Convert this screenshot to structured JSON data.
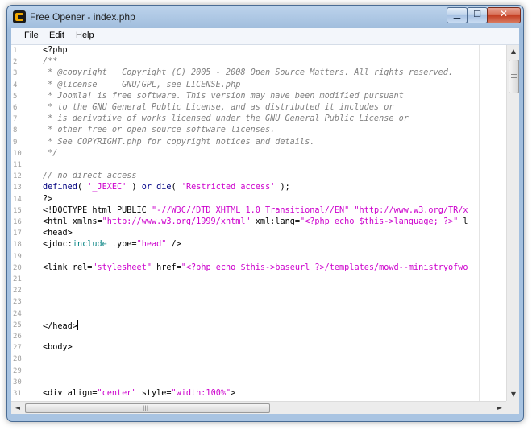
{
  "window": {
    "title": "Free Opener - index.php",
    "icon": "app-icon",
    "controls": {
      "minimize": "▁",
      "maximize": "☐",
      "close": "✕"
    }
  },
  "menubar": {
    "items": [
      "File",
      "Edit",
      "Help"
    ]
  },
  "editor": {
    "lines": [
      {
        "n": "1",
        "tokens": [
          {
            "t": "<?php",
            "c": "default"
          }
        ]
      },
      {
        "n": "2",
        "tokens": [
          {
            "t": "/**",
            "c": "comment"
          }
        ]
      },
      {
        "n": "3",
        "tokens": [
          {
            "t": " * @copyright   Copyright (C) 2005 - 2008 Open Source Matters. All rights reserved.",
            "c": "comment"
          }
        ]
      },
      {
        "n": "4",
        "tokens": [
          {
            "t": " * @license     GNU/GPL, see LICENSE.php",
            "c": "comment"
          }
        ]
      },
      {
        "n": "5",
        "tokens": [
          {
            "t": " * Joomla! is free software. This version may have been modified pursuant",
            "c": "comment"
          }
        ]
      },
      {
        "n": "6",
        "tokens": [
          {
            "t": " * to the GNU General Public License, and as distributed it includes or",
            "c": "comment"
          }
        ]
      },
      {
        "n": "7",
        "tokens": [
          {
            "t": " * is derivative of works licensed under the GNU General Public License or",
            "c": "comment"
          }
        ]
      },
      {
        "n": "8",
        "tokens": [
          {
            "t": " * other free or open source software licenses.",
            "c": "comment"
          }
        ]
      },
      {
        "n": "9",
        "tokens": [
          {
            "t": " * See COPYRIGHT.php for copyright notices and details.",
            "c": "comment"
          }
        ]
      },
      {
        "n": "10",
        "tokens": [
          {
            "t": " */",
            "c": "comment"
          }
        ]
      },
      {
        "n": "11",
        "tokens": []
      },
      {
        "n": "12",
        "tokens": [
          {
            "t": "// no direct access",
            "c": "comment"
          }
        ]
      },
      {
        "n": "13",
        "tokens": [
          {
            "t": "defined",
            "c": "func"
          },
          {
            "t": "( ",
            "c": "default"
          },
          {
            "t": "'_JEXEC'",
            "c": "string"
          },
          {
            "t": " ) ",
            "c": "default"
          },
          {
            "t": "or",
            "c": "keyword"
          },
          {
            "t": " ",
            "c": "default"
          },
          {
            "t": "die",
            "c": "func"
          },
          {
            "t": "( ",
            "c": "default"
          },
          {
            "t": "'Restricted access'",
            "c": "string"
          },
          {
            "t": " );",
            "c": "default"
          }
        ]
      },
      {
        "n": "14",
        "tokens": [
          {
            "t": "?>",
            "c": "default"
          }
        ]
      },
      {
        "n": "15",
        "tokens": [
          {
            "t": "<!DOCTYPE html PUBLIC ",
            "c": "tag"
          },
          {
            "t": "\"-//W3C//DTD XHTML 1.0 Transitional//EN\"",
            "c": "attrval"
          },
          {
            "t": " ",
            "c": "default"
          },
          {
            "t": "\"http://www.w3.org/TR/x",
            "c": "attrval"
          }
        ]
      },
      {
        "n": "16",
        "tokens": [
          {
            "t": "<html ",
            "c": "tag"
          },
          {
            "t": "xmlns=",
            "c": "attr"
          },
          {
            "t": "\"http://www.w3.org/1999/xhtml\"",
            "c": "attrval"
          },
          {
            "t": " xml:lang=",
            "c": "attr"
          },
          {
            "t": "\"<?php echo $this->language; ?>\"",
            "c": "attrval"
          },
          {
            "t": " l",
            "c": "attr"
          }
        ]
      },
      {
        "n": "17",
        "tokens": [
          {
            "t": "<head>",
            "c": "tag"
          }
        ]
      },
      {
        "n": "18",
        "tokens": [
          {
            "t": "<jdoc:",
            "c": "tag"
          },
          {
            "t": "include",
            "c": "teal"
          },
          {
            "t": " type=",
            "c": "attr"
          },
          {
            "t": "\"head\"",
            "c": "attrval"
          },
          {
            "t": " />",
            "c": "tag"
          }
        ]
      },
      {
        "n": "19",
        "tokens": []
      },
      {
        "n": "20",
        "tokens": [
          {
            "t": "<link ",
            "c": "tag"
          },
          {
            "t": "rel=",
            "c": "attr"
          },
          {
            "t": "\"stylesheet\"",
            "c": "attrval"
          },
          {
            "t": " href=",
            "c": "attr"
          },
          {
            "t": "\"<?php echo $this->baseurl ?>/templates/mowd--ministryofwo",
            "c": "attrval"
          }
        ]
      },
      {
        "n": "21",
        "tokens": []
      },
      {
        "n": "22",
        "tokens": []
      },
      {
        "n": "23",
        "tokens": []
      },
      {
        "n": "24",
        "tokens": []
      },
      {
        "n": "25",
        "tokens": [
          {
            "t": "</head>",
            "c": "tag"
          }
        ],
        "caret": true
      },
      {
        "n": "26",
        "tokens": []
      },
      {
        "n": "27",
        "tokens": [
          {
            "t": "<body>",
            "c": "tag"
          }
        ]
      },
      {
        "n": "28",
        "tokens": []
      },
      {
        "n": "29",
        "tokens": []
      },
      {
        "n": "30",
        "tokens": []
      },
      {
        "n": "31",
        "tokens": [
          {
            "t": "<div ",
            "c": "tag"
          },
          {
            "t": "align=",
            "c": "attr"
          },
          {
            "t": "\"center\"",
            "c": "attrval"
          },
          {
            "t": " style=",
            "c": "attr"
          },
          {
            "t": "\"width:100%\"",
            "c": "attrval"
          },
          {
            "t": ">",
            "c": "tag"
          }
        ]
      }
    ]
  },
  "scrollbars": {
    "vertical": {
      "up": "▲",
      "down": "▼",
      "position_fraction": 0.0
    },
    "horizontal": {
      "left": "◄",
      "right": "►",
      "grip": "|||",
      "position_fraction": 0.0
    }
  },
  "colors": {
    "comment": "#808080",
    "string": "#cc00cc",
    "keyword": "#00008b",
    "line_number": "#a0a0a0"
  }
}
